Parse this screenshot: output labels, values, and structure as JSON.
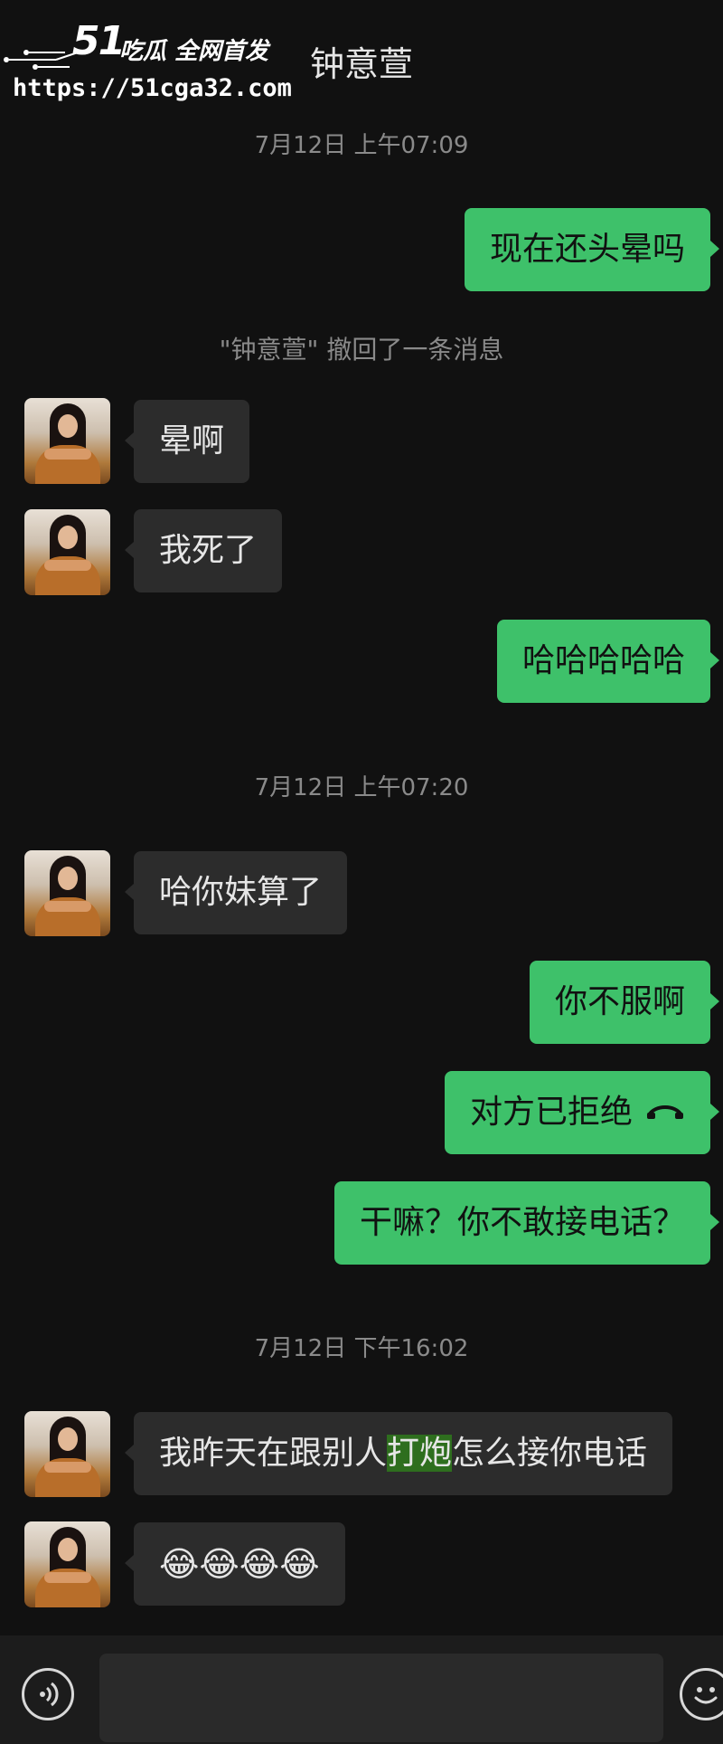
{
  "header": {
    "title": "钟意萱"
  },
  "watermark": {
    "brand": "51",
    "tagline": "吃瓜 全网首发",
    "url": "https://51cga32.com"
  },
  "chat": {
    "timestamps": [
      "7月12日 上午07:09",
      "7月12日 上午07:20",
      "7月12日 下午16:02"
    ],
    "recall_notice": "\"钟意萱\" 撤回了一条消息",
    "messages": [
      {
        "from": "me",
        "text": "现在还头晕吗"
      },
      {
        "from": "contact",
        "text": "晕啊"
      },
      {
        "from": "contact",
        "text": "我死了"
      },
      {
        "from": "me",
        "text": "哈哈哈哈哈"
      },
      {
        "from": "contact",
        "text": "哈你妹算了"
      },
      {
        "from": "me",
        "text": "你不服啊"
      },
      {
        "from": "me",
        "text": "对方已拒绝",
        "icon": "phone-hangup-icon"
      },
      {
        "from": "me",
        "text": "干嘛？你不敢接电话？"
      },
      {
        "from": "contact",
        "text_before": "我昨天在跟别人",
        "text_highlight": "打炮",
        "text_after": "怎么接你电话"
      },
      {
        "from": "contact",
        "text": "😂😂😂😂"
      }
    ]
  },
  "colors": {
    "background": "#111111",
    "sent_bubble": "#3ec16a",
    "received_bubble": "#2c2c2c",
    "highlight": "#2e6e1e",
    "meta_text": "#8a8a8a"
  },
  "bottom_bar": {
    "voice_icon": "voice-icon",
    "emoji_icon": "emoji-icon"
  }
}
